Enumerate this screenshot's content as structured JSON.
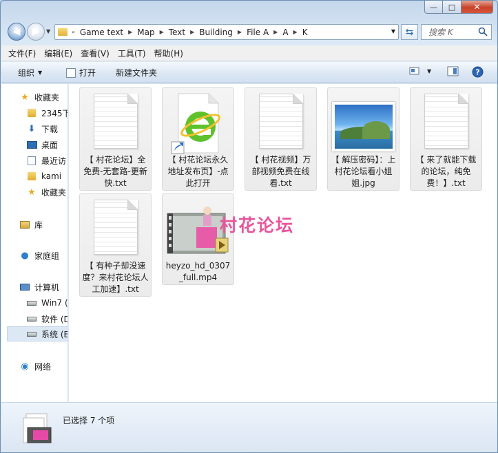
{
  "window": {
    "controls": {
      "minimize": "—",
      "maximize": "□",
      "close": "✕"
    }
  },
  "address": {
    "breadcrumbs": [
      "Game text",
      "Map",
      "Text",
      "Building",
      "File A",
      "A",
      "K"
    ],
    "search_placeholder": "搜索 K"
  },
  "menu": [
    "文件(F)",
    "编辑(E)",
    "查看(V)",
    "工具(T)",
    "帮助(H)"
  ],
  "toolbar": {
    "organize": "组织",
    "open": "打开",
    "new_folder": "新建文件夹"
  },
  "sidebar": {
    "items": [
      {
        "label": "收藏夹",
        "icon": "star-icon"
      },
      {
        "label": "2345下",
        "icon": "folder-icon"
      },
      {
        "label": "下载",
        "icon": "download-folder-icon"
      },
      {
        "label": "桌面",
        "icon": "desktop-icon"
      },
      {
        "label": "最近访",
        "icon": "recent-icon"
      },
      {
        "label": "kami",
        "icon": "folder-icon"
      },
      {
        "label": "收藏夹",
        "icon": "star-icon"
      },
      {
        "label": "库",
        "icon": "library-icon"
      },
      {
        "label": "家庭组",
        "icon": "homegroup-icon"
      },
      {
        "label": "计算机",
        "icon": "computer-icon"
      },
      {
        "label": "Win7 (",
        "icon": "drive-icon"
      },
      {
        "label": "软件 (D",
        "icon": "drive-icon"
      },
      {
        "label": "系统 (E",
        "icon": "drive-icon"
      },
      {
        "label": "网络",
        "icon": "network-icon"
      }
    ]
  },
  "files": [
    {
      "name": "【 村花论坛】全免费-无套路-更新快.txt",
      "type": "txt"
    },
    {
      "name": "【 村花论坛永久地址发布页】-点此打开",
      "type": "url"
    },
    {
      "name": "【 村花视频】万部视频免费在线看.txt",
      "type": "txt"
    },
    {
      "name": "【 解压密码】：上村花论坛看小姐姐.jpg",
      "type": "jpg"
    },
    {
      "name": "【 来了就能下载的论坛，纯免费！】.txt",
      "type": "txt"
    },
    {
      "name": "【 有种子却没速度？来村花论坛人工加速】.txt",
      "type": "txt"
    },
    {
      "name": "heyzo_hd_0307_full.mp4",
      "type": "mp4"
    }
  ],
  "overlay_text": "村花论坛",
  "status": {
    "selected_text": "已选择 7 个项"
  }
}
